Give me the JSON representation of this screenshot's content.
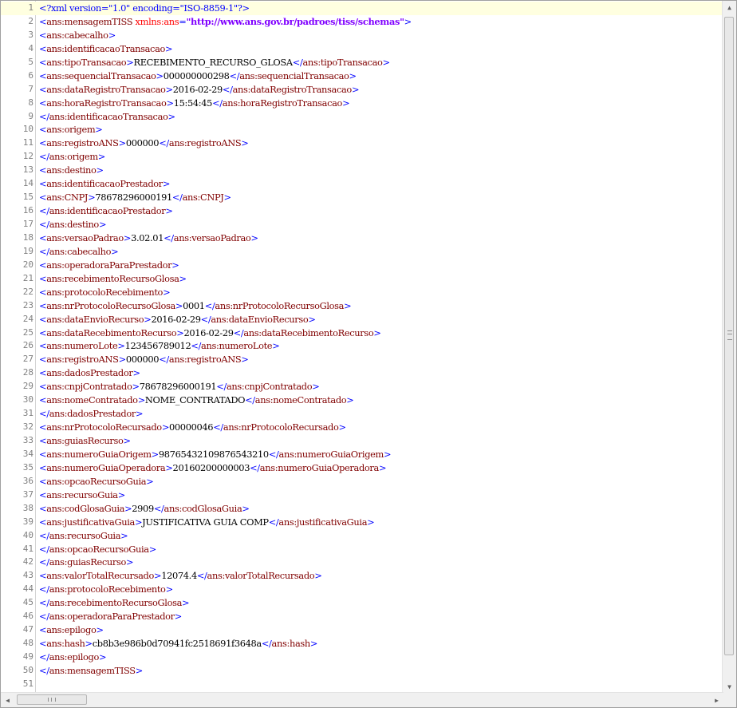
{
  "editor": {
    "lines": [
      [
        [
          "b",
          "<?xml version=\"1.0\" encoding=\"ISO-8859-1\"?>"
        ]
      ],
      [
        [
          "b",
          "<"
        ],
        [
          "t",
          "ans:mensagemTISS"
        ],
        [
          "x",
          " "
        ],
        [
          "a",
          "xmlns:ans"
        ],
        [
          "b",
          "="
        ],
        [
          "s",
          "\"http://www.ans.gov.br/padroes/tiss/schemas\""
        ],
        [
          "b",
          ">"
        ]
      ],
      [
        [
          "b",
          "<"
        ],
        [
          "t",
          "ans:cabecalho"
        ],
        [
          "b",
          ">"
        ]
      ],
      [
        [
          "b",
          "<"
        ],
        [
          "t",
          "ans:identificacaoTransacao"
        ],
        [
          "b",
          ">"
        ]
      ],
      [
        [
          "b",
          "<"
        ],
        [
          "t",
          "ans:tipoTransacao"
        ],
        [
          "b",
          ">"
        ],
        [
          "x",
          "RECEBIMENTO_RECURSO_GLOSA"
        ],
        [
          "b",
          "</"
        ],
        [
          "t",
          "ans:tipoTransacao"
        ],
        [
          "b",
          ">"
        ]
      ],
      [
        [
          "b",
          "<"
        ],
        [
          "t",
          "ans:sequencialTransacao"
        ],
        [
          "b",
          ">"
        ],
        [
          "x",
          "000000000298"
        ],
        [
          "b",
          "</"
        ],
        [
          "t",
          "ans:sequencialTransacao"
        ],
        [
          "b",
          ">"
        ]
      ],
      [
        [
          "b",
          "<"
        ],
        [
          "t",
          "ans:dataRegistroTransacao"
        ],
        [
          "b",
          ">"
        ],
        [
          "x",
          "2016-02-29"
        ],
        [
          "b",
          "</"
        ],
        [
          "t",
          "ans:dataRegistroTransacao"
        ],
        [
          "b",
          ">"
        ]
      ],
      [
        [
          "b",
          "<"
        ],
        [
          "t",
          "ans:horaRegistroTransacao"
        ],
        [
          "b",
          ">"
        ],
        [
          "x",
          "15:54:45"
        ],
        [
          "b",
          "</"
        ],
        [
          "t",
          "ans:horaRegistroTransacao"
        ],
        [
          "b",
          ">"
        ]
      ],
      [
        [
          "b",
          "</"
        ],
        [
          "t",
          "ans:identificacaoTransacao"
        ],
        [
          "b",
          ">"
        ]
      ],
      [
        [
          "b",
          "<"
        ],
        [
          "t",
          "ans:origem"
        ],
        [
          "b",
          ">"
        ]
      ],
      [
        [
          "b",
          "<"
        ],
        [
          "t",
          "ans:registroANS"
        ],
        [
          "b",
          ">"
        ],
        [
          "x",
          "000000"
        ],
        [
          "b",
          "</"
        ],
        [
          "t",
          "ans:registroANS"
        ],
        [
          "b",
          ">"
        ]
      ],
      [
        [
          "b",
          "</"
        ],
        [
          "t",
          "ans:origem"
        ],
        [
          "b",
          ">"
        ]
      ],
      [
        [
          "b",
          "<"
        ],
        [
          "t",
          "ans:destino"
        ],
        [
          "b",
          ">"
        ]
      ],
      [
        [
          "b",
          "<"
        ],
        [
          "t",
          "ans:identificacaoPrestador"
        ],
        [
          "b",
          ">"
        ]
      ],
      [
        [
          "b",
          "<"
        ],
        [
          "t",
          "ans:CNPJ"
        ],
        [
          "b",
          ">"
        ],
        [
          "x",
          "78678296000191"
        ],
        [
          "b",
          "</"
        ],
        [
          "t",
          "ans:CNPJ"
        ],
        [
          "b",
          ">"
        ]
      ],
      [
        [
          "b",
          "</"
        ],
        [
          "t",
          "ans:identificacaoPrestador"
        ],
        [
          "b",
          ">"
        ]
      ],
      [
        [
          "b",
          "</"
        ],
        [
          "t",
          "ans:destino"
        ],
        [
          "b",
          ">"
        ]
      ],
      [
        [
          "b",
          "<"
        ],
        [
          "t",
          "ans:versaoPadrao"
        ],
        [
          "b",
          ">"
        ],
        [
          "x",
          "3.02.01"
        ],
        [
          "b",
          "</"
        ],
        [
          "t",
          "ans:versaoPadrao"
        ],
        [
          "b",
          ">"
        ]
      ],
      [
        [
          "b",
          "</"
        ],
        [
          "t",
          "ans:cabecalho"
        ],
        [
          "b",
          ">"
        ]
      ],
      [
        [
          "b",
          "<"
        ],
        [
          "t",
          "ans:operadoraParaPrestador"
        ],
        [
          "b",
          ">"
        ]
      ],
      [
        [
          "b",
          "<"
        ],
        [
          "t",
          "ans:recebimentoRecursoGlosa"
        ],
        [
          "b",
          ">"
        ]
      ],
      [
        [
          "b",
          "<"
        ],
        [
          "t",
          "ans:protocoloRecebimento"
        ],
        [
          "b",
          ">"
        ]
      ],
      [
        [
          "b",
          "<"
        ],
        [
          "t",
          "ans:nrProtocoloRecursoGlosa"
        ],
        [
          "b",
          ">"
        ],
        [
          "x",
          "0001"
        ],
        [
          "b",
          "</"
        ],
        [
          "t",
          "ans:nrProtocoloRecursoGlosa"
        ],
        [
          "b",
          ">"
        ]
      ],
      [
        [
          "b",
          "<"
        ],
        [
          "t",
          "ans:dataEnvioRecurso"
        ],
        [
          "b",
          ">"
        ],
        [
          "x",
          "2016-02-29"
        ],
        [
          "b",
          "</"
        ],
        [
          "t",
          "ans:dataEnvioRecurso"
        ],
        [
          "b",
          ">"
        ]
      ],
      [
        [
          "b",
          "<"
        ],
        [
          "t",
          "ans:dataRecebimentoRecurso"
        ],
        [
          "b",
          ">"
        ],
        [
          "x",
          "2016-02-29"
        ],
        [
          "b",
          "</"
        ],
        [
          "t",
          "ans:dataRecebimentoRecurso"
        ],
        [
          "b",
          ">"
        ]
      ],
      [
        [
          "b",
          "<"
        ],
        [
          "t",
          "ans:numeroLote"
        ],
        [
          "b",
          ">"
        ],
        [
          "x",
          "123456789012"
        ],
        [
          "b",
          "</"
        ],
        [
          "t",
          "ans:numeroLote"
        ],
        [
          "b",
          ">"
        ]
      ],
      [
        [
          "b",
          "<"
        ],
        [
          "t",
          "ans:registroANS"
        ],
        [
          "b",
          ">"
        ],
        [
          "x",
          "000000"
        ],
        [
          "b",
          "</"
        ],
        [
          "t",
          "ans:registroANS"
        ],
        [
          "b",
          ">"
        ]
      ],
      [
        [
          "b",
          "<"
        ],
        [
          "t",
          "ans:dadosPrestador"
        ],
        [
          "b",
          ">"
        ]
      ],
      [
        [
          "b",
          "<"
        ],
        [
          "t",
          "ans:cnpjContratado"
        ],
        [
          "b",
          ">"
        ],
        [
          "x",
          "78678296000191"
        ],
        [
          "b",
          "</"
        ],
        [
          "t",
          "ans:cnpjContratado"
        ],
        [
          "b",
          ">"
        ]
      ],
      [
        [
          "b",
          "<"
        ],
        [
          "t",
          "ans:nomeContratado"
        ],
        [
          "b",
          ">"
        ],
        [
          "x",
          "NOME_CONTRATADO"
        ],
        [
          "b",
          "</"
        ],
        [
          "t",
          "ans:nomeContratado"
        ],
        [
          "b",
          ">"
        ]
      ],
      [
        [
          "b",
          "</"
        ],
        [
          "t",
          "ans:dadosPrestador"
        ],
        [
          "b",
          ">"
        ]
      ],
      [
        [
          "b",
          "<"
        ],
        [
          "t",
          "ans:nrProtocoloRecursado"
        ],
        [
          "b",
          ">"
        ],
        [
          "x",
          "00000046"
        ],
        [
          "b",
          "</"
        ],
        [
          "t",
          "ans:nrProtocoloRecursado"
        ],
        [
          "b",
          ">"
        ]
      ],
      [
        [
          "b",
          "<"
        ],
        [
          "t",
          "ans:guiasRecurso"
        ],
        [
          "b",
          ">"
        ]
      ],
      [
        [
          "b",
          "<"
        ],
        [
          "t",
          "ans:numeroGuiaOrigem"
        ],
        [
          "b",
          ">"
        ],
        [
          "x",
          "98765432109876543210"
        ],
        [
          "b",
          "</"
        ],
        [
          "t",
          "ans:numeroGuiaOrigem"
        ],
        [
          "b",
          ">"
        ]
      ],
      [
        [
          "b",
          "<"
        ],
        [
          "t",
          "ans:numeroGuiaOperadora"
        ],
        [
          "b",
          ">"
        ],
        [
          "x",
          "20160200000003"
        ],
        [
          "b",
          "</"
        ],
        [
          "t",
          "ans:numeroGuiaOperadora"
        ],
        [
          "b",
          ">"
        ]
      ],
      [
        [
          "b",
          "<"
        ],
        [
          "t",
          "ans:opcaoRecursoGuia"
        ],
        [
          "b",
          ">"
        ]
      ],
      [
        [
          "b",
          "<"
        ],
        [
          "t",
          "ans:recursoGuia"
        ],
        [
          "b",
          ">"
        ]
      ],
      [
        [
          "b",
          "<"
        ],
        [
          "t",
          "ans:codGlosaGuia"
        ],
        [
          "b",
          ">"
        ],
        [
          "x",
          "2909"
        ],
        [
          "b",
          "</"
        ],
        [
          "t",
          "ans:codGlosaGuia"
        ],
        [
          "b",
          ">"
        ]
      ],
      [
        [
          "b",
          "<"
        ],
        [
          "t",
          "ans:justificativaGuia"
        ],
        [
          "b",
          ">"
        ],
        [
          "x",
          "JUSTIFICATIVA GUIA COMP"
        ],
        [
          "b",
          "</"
        ],
        [
          "t",
          "ans:justificativaGuia"
        ],
        [
          "b",
          ">"
        ]
      ],
      [
        [
          "b",
          "</"
        ],
        [
          "t",
          "ans:recursoGuia"
        ],
        [
          "b",
          ">"
        ]
      ],
      [
        [
          "b",
          "</"
        ],
        [
          "t",
          "ans:opcaoRecursoGuia"
        ],
        [
          "b",
          ">"
        ]
      ],
      [
        [
          "b",
          "</"
        ],
        [
          "t",
          "ans:guiasRecurso"
        ],
        [
          "b",
          ">"
        ]
      ],
      [
        [
          "b",
          "<"
        ],
        [
          "t",
          "ans:valorTotalRecursado"
        ],
        [
          "b",
          ">"
        ],
        [
          "x",
          "12074.4"
        ],
        [
          "b",
          "</"
        ],
        [
          "t",
          "ans:valorTotalRecursado"
        ],
        [
          "b",
          ">"
        ]
      ],
      [
        [
          "b",
          "</"
        ],
        [
          "t",
          "ans:protocoloRecebimento"
        ],
        [
          "b",
          ">"
        ]
      ],
      [
        [
          "b",
          "</"
        ],
        [
          "t",
          "ans:recebimentoRecursoGlosa"
        ],
        [
          "b",
          ">"
        ]
      ],
      [
        [
          "b",
          "</"
        ],
        [
          "t",
          "ans:operadoraParaPrestador"
        ],
        [
          "b",
          ">"
        ]
      ],
      [
        [
          "b",
          "<"
        ],
        [
          "t",
          "ans:epilogo"
        ],
        [
          "b",
          ">"
        ]
      ],
      [
        [
          "b",
          "<"
        ],
        [
          "t",
          "ans:hash"
        ],
        [
          "b",
          ">"
        ],
        [
          "x",
          "cb8b3e986b0d70941fc2518691f3648a"
        ],
        [
          "b",
          "</"
        ],
        [
          "t",
          "ans:hash"
        ],
        [
          "b",
          ">"
        ]
      ],
      [
        [
          "b",
          "</"
        ],
        [
          "t",
          "ans:epilogo"
        ],
        [
          "b",
          ">"
        ]
      ],
      [
        [
          "b",
          "</"
        ],
        [
          "t",
          "ans:mensagemTISS"
        ],
        [
          "b",
          ">"
        ]
      ],
      []
    ],
    "current_line": 1,
    "colors": {
      "b": "#0000ff",
      "t": "#800000",
      "x": "#000000",
      "a": "#ff0000",
      "s": "#8000ff",
      "current_line_bg": "#ffffe0",
      "line_number": "#808080"
    }
  },
  "scrollbars": {
    "vertical": {
      "up_icon": "arrow-up-icon",
      "down_icon": "arrow-down-icon",
      "grip_icon": "grip-icon"
    },
    "horizontal": {
      "left_icon": "arrow-left-icon",
      "right_icon": "arrow-right-icon",
      "grip_icon": "grip-icon"
    }
  }
}
